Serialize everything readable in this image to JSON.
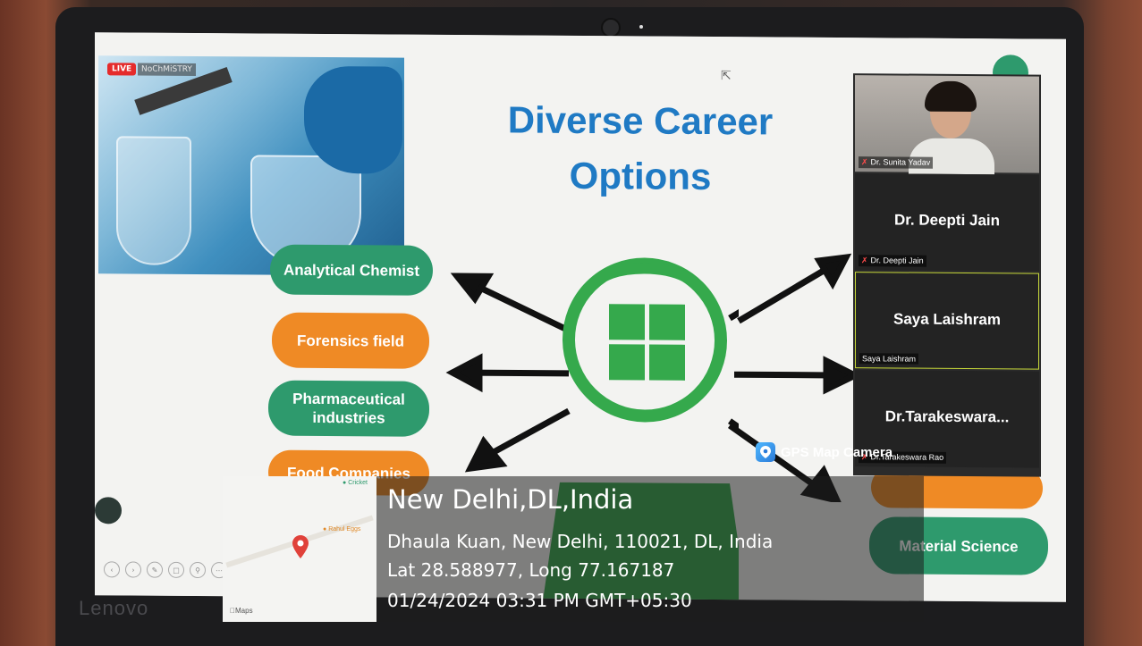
{
  "slide": {
    "title_line1": "Diverse Career",
    "title_line2": "Options",
    "options_left": [
      "Analytical Chemist",
      "Forensics field",
      "Pharmaceutical industries",
      "Food Companies"
    ],
    "options_right": [
      "Material Science"
    ]
  },
  "video": {
    "live_badge": "LIVE",
    "channel_text": "NoChMiSTRY"
  },
  "participants": [
    {
      "name": "",
      "tag": "Dr. Sunita Yadav",
      "muted": true
    },
    {
      "name": "Dr. Deepti Jain",
      "tag": "Dr. Deepti Jain",
      "muted": true
    },
    {
      "name": "Saya Laishram",
      "tag": "Saya Laishram",
      "muted": false
    },
    {
      "name": "Dr.Tarakeswara...",
      "tag": "Dr.Tarakeswara Rao",
      "muted": true
    }
  ],
  "gps_overlay": {
    "app_label": "GPS Map Camera",
    "city": "New Delhi,DL,India",
    "address": "Dhaula Kuan, New Delhi, 110021, DL, India",
    "coords": "Lat 28.588977, Long 77.167187",
    "datetime": "01/24/2024 03:31 PM GMT+05:30",
    "map_labels": [
      "Rahul Eggs",
      "Cricket"
    ],
    "map_brand": "Maps"
  },
  "laptop_brand": "Lenovo",
  "colors": {
    "title_blue": "#1f7ac4",
    "pill_green": "#2e9a6d",
    "pill_orange": "#ef8a25",
    "head_green": "#35a94c"
  }
}
